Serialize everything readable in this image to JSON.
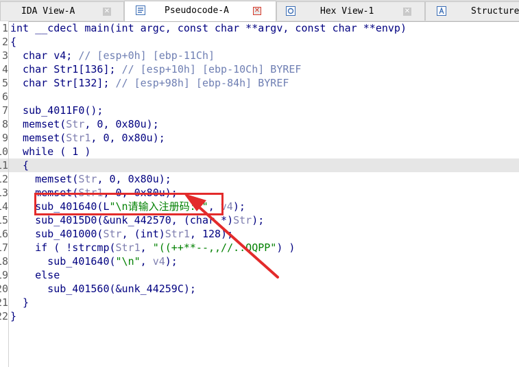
{
  "tabs": [
    {
      "label": "IDA View-A",
      "icon": "list-view-icon",
      "active": false
    },
    {
      "label": "Pseudocode-A",
      "icon": "pseudocode-icon",
      "active": true
    },
    {
      "label": "Hex View-1",
      "icon": "hex-view-icon",
      "active": false
    },
    {
      "label": "Structure",
      "icon": "structures-icon",
      "active": false
    }
  ],
  "close_glyph": "✕",
  "line_numbers": [
    "1",
    "2",
    "3",
    "4",
    "5",
    "6",
    "7",
    "8",
    "9",
    "10",
    "11",
    "12",
    "13",
    "14",
    "15",
    "16",
    "17",
    "18",
    "19",
    "20",
    "21",
    "22"
  ],
  "code": {
    "l1": "int __cdecl main(int argc, const char **argv, const char **envp)",
    "l2": "{",
    "l3_decl": "  char v4; ",
    "l3_cm": "// [esp+0h] [ebp-11Ch]",
    "l4_decl": "  char Str1[136]; ",
    "l4_cm": "// [esp+10h] [ebp-10Ch] BYREF",
    "l5_decl": "  char Str[132]; ",
    "l5_cm": "// [esp+98h] [ebp-84h] BYREF",
    "l6": "",
    "l7": "  sub_4011F0();",
    "l8_a": "  memset(",
    "l8_v": "Str",
    "l8_b": ", 0, 0x80u);",
    "l9_a": "  memset(",
    "l9_v": "Str1",
    "l9_b": ", 0, 0x80u);",
    "l10": "  while ( 1 )",
    "l11": "  {",
    "l12_a": "    memset(",
    "l12_v": "Str",
    "l12_b": ", 0, 0x80u);",
    "l13_a": "    memset(",
    "l13_v": "Str1",
    "l13_b": ", 0, 0x80u);",
    "l14_a": "    sub_401640(L",
    "l14_s": "\"\\n请输入注册码: \"",
    "l14_b": ", ",
    "l14_v": "v4",
    "l14_c": ");",
    "l15_a": "    sub_4015D0(&unk_442570, (char *)",
    "l15_v": "Str",
    "l15_b": ");",
    "l16_a": "    sub_401000(",
    "l16_v": "Str",
    "l16_b": ", (int)",
    "l16_v2": "Str1",
    "l16_c": ", 128);",
    "l17_a": "    if ( !strcmp(",
    "l17_v": "Str1",
    "l17_b": ", ",
    "l17_s": "\"((++**--,,//..QQPP\"",
    "l17_c": ") )",
    "l18_a": "      sub_401640(",
    "l18_s": "\"\\n\"",
    "l18_b": ", ",
    "l18_v": "v4",
    "l18_c": ");",
    "l19": "    else",
    "l20": "      sub_401560(&unk_44259C);",
    "l21": "  }",
    "l22": "}"
  },
  "colors": {
    "keyword": "#000080",
    "comment": "#6f7fb3",
    "variable": "#7f7fb0",
    "string": "#008000",
    "highlight": "#e32b2b"
  }
}
